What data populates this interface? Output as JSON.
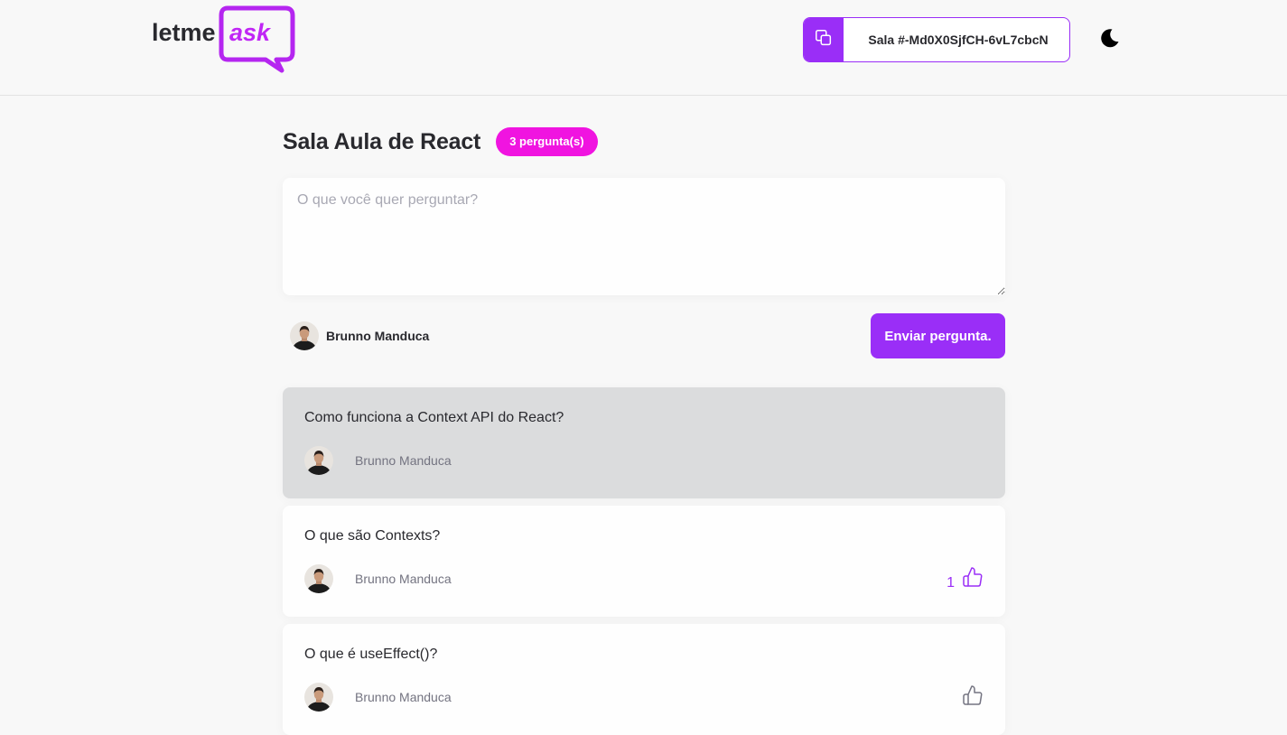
{
  "header": {
    "logo_text_plain": "letme",
    "logo_text_accent": "ask",
    "room_code_label": "Sala #-Md0X0SjfCH-6vL7cbcN",
    "copy_icon": "copy-icon",
    "theme_icon": "moon-icon"
  },
  "room": {
    "title": "Sala Aula de React",
    "question_count": "3 pergunta(s)"
  },
  "form": {
    "placeholder": "O que você quer perguntar?",
    "user_name": "Brunno Manduca",
    "submit_label": "Enviar pergunta."
  },
  "questions": [
    {
      "content": "Como funciona a Context API do React?",
      "author": "Brunno Manduca",
      "highlighted": true
    },
    {
      "content": "O que são Contexts?",
      "author": "Brunno Manduca",
      "like_count": "1",
      "liked": true
    },
    {
      "content": "O que é useEffect()?",
      "author": "Brunno Manduca",
      "like_count": "",
      "liked": false
    }
  ],
  "colors": {
    "accent": "#9a2ef7",
    "badge": "#f014e0",
    "background": "#f8f8f8",
    "highlight": "#dbdcdd"
  }
}
